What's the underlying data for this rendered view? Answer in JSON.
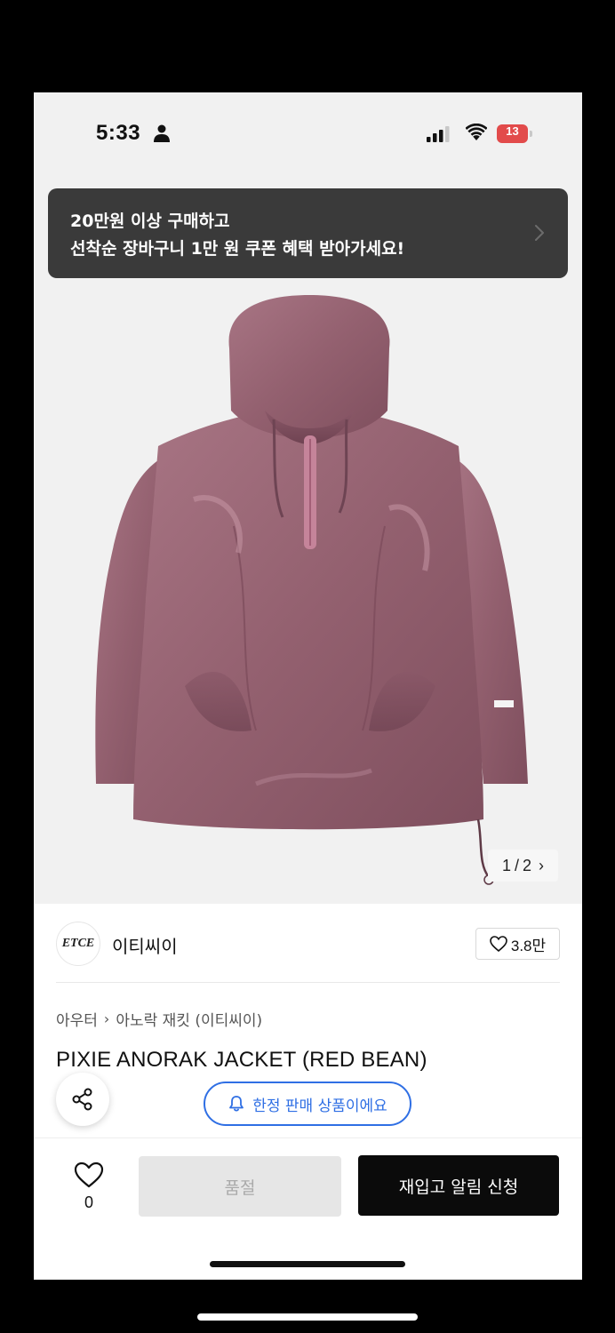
{
  "status_bar": {
    "time": "5:33",
    "battery_level": "13",
    "battery_fraction": 0.13,
    "battery_color": "#e23b3b",
    "icons": [
      "person-icon",
      "signal-icon",
      "wifi-icon",
      "battery-icon"
    ]
  },
  "promo_banner": {
    "line1": "20만원 이상 구매하고",
    "line2": "선착순 장바구니 1만 원 쿠폰 혜택 받아가세요!",
    "icon": "chevron-right-icon"
  },
  "gallery": {
    "current": "1",
    "separator": "/",
    "total": "2",
    "arrow": "›",
    "image_description_color": "#9b6574"
  },
  "brand": {
    "logo_text": "ETCE",
    "name": "이티씨이",
    "likes": "3.8만"
  },
  "breadcrumb": {
    "items": [
      "아우터",
      "아노락 재킷 (이티씨이)"
    ],
    "separator": "›"
  },
  "product": {
    "title": "PIXIE ANORAK JACKET (RED BEAN)",
    "limited_label": "한정 판매 상품이에요"
  },
  "bottom_bar": {
    "wish_count": "0",
    "soldout_label": "품절",
    "restock_label": "재입고 알림 신청"
  },
  "colors": {
    "accent_blue": "#2f6fe4",
    "button_dark": "#0b0b0b",
    "banner_bg": "#3a3a3a"
  }
}
